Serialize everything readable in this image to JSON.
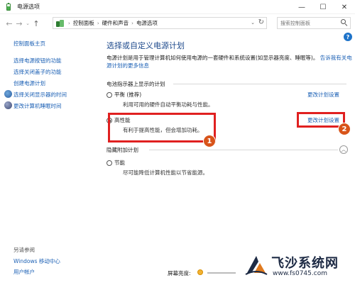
{
  "window": {
    "title": "电源选项",
    "controls": {
      "minimize": "—",
      "maximize": "☐",
      "close": "✕"
    }
  },
  "address": {
    "back": "←",
    "forward": "→",
    "recent": "⌄",
    "up": "↑",
    "breadcrumbs": [
      "控制面板",
      "硬件和声音",
      "电源选项"
    ],
    "search_placeholder": "搜索控制面板"
  },
  "sidebar": {
    "home": "控制面板主页",
    "links": [
      "选择电源按钮的功能",
      "选择关闭盖子的功能",
      "创建电源计划",
      "选择关闭显示器的时间",
      "更改计算机睡眠时间"
    ],
    "see_also": {
      "title": "另请参阅",
      "links": [
        "Windows 移动中心",
        "用户帐户"
      ]
    }
  },
  "main": {
    "heading": "选择或自定义电源计划",
    "description": "电源计划是用于管理计算机如何使用电源的一套硬件和系统设置(如显示器亮度、睡眠等)。",
    "description_link": "告诉我有关电源计划的更多信息",
    "battery_section": "电池指示器上显示的计划",
    "plans": [
      {
        "name": "平衡 (推荐)",
        "desc": "利用可用的硬件自动平衡功耗与性能。",
        "link": "更改计划设置",
        "selected": false
      },
      {
        "name": "高性能",
        "desc": "有利于提高性能，但会增加功耗。",
        "link": "更改计划设置",
        "selected": true
      }
    ],
    "hidden_section": "隐藏附加计划",
    "hidden_plans": [
      {
        "name": "节能",
        "desc": "尽可能降低计算机性能以节省能源。",
        "selected": false
      }
    ]
  },
  "bottom": {
    "brightness_label": "屏幕亮度:"
  },
  "annotations": [
    "1",
    "2"
  ],
  "watermark": {
    "title": "飞沙系统网",
    "url": "www.fs0745.com"
  },
  "colors": {
    "link": "#1a5fb4",
    "heading": "#1e4a8c",
    "annotation_box": "#e02020",
    "badge": "#d8541a"
  }
}
